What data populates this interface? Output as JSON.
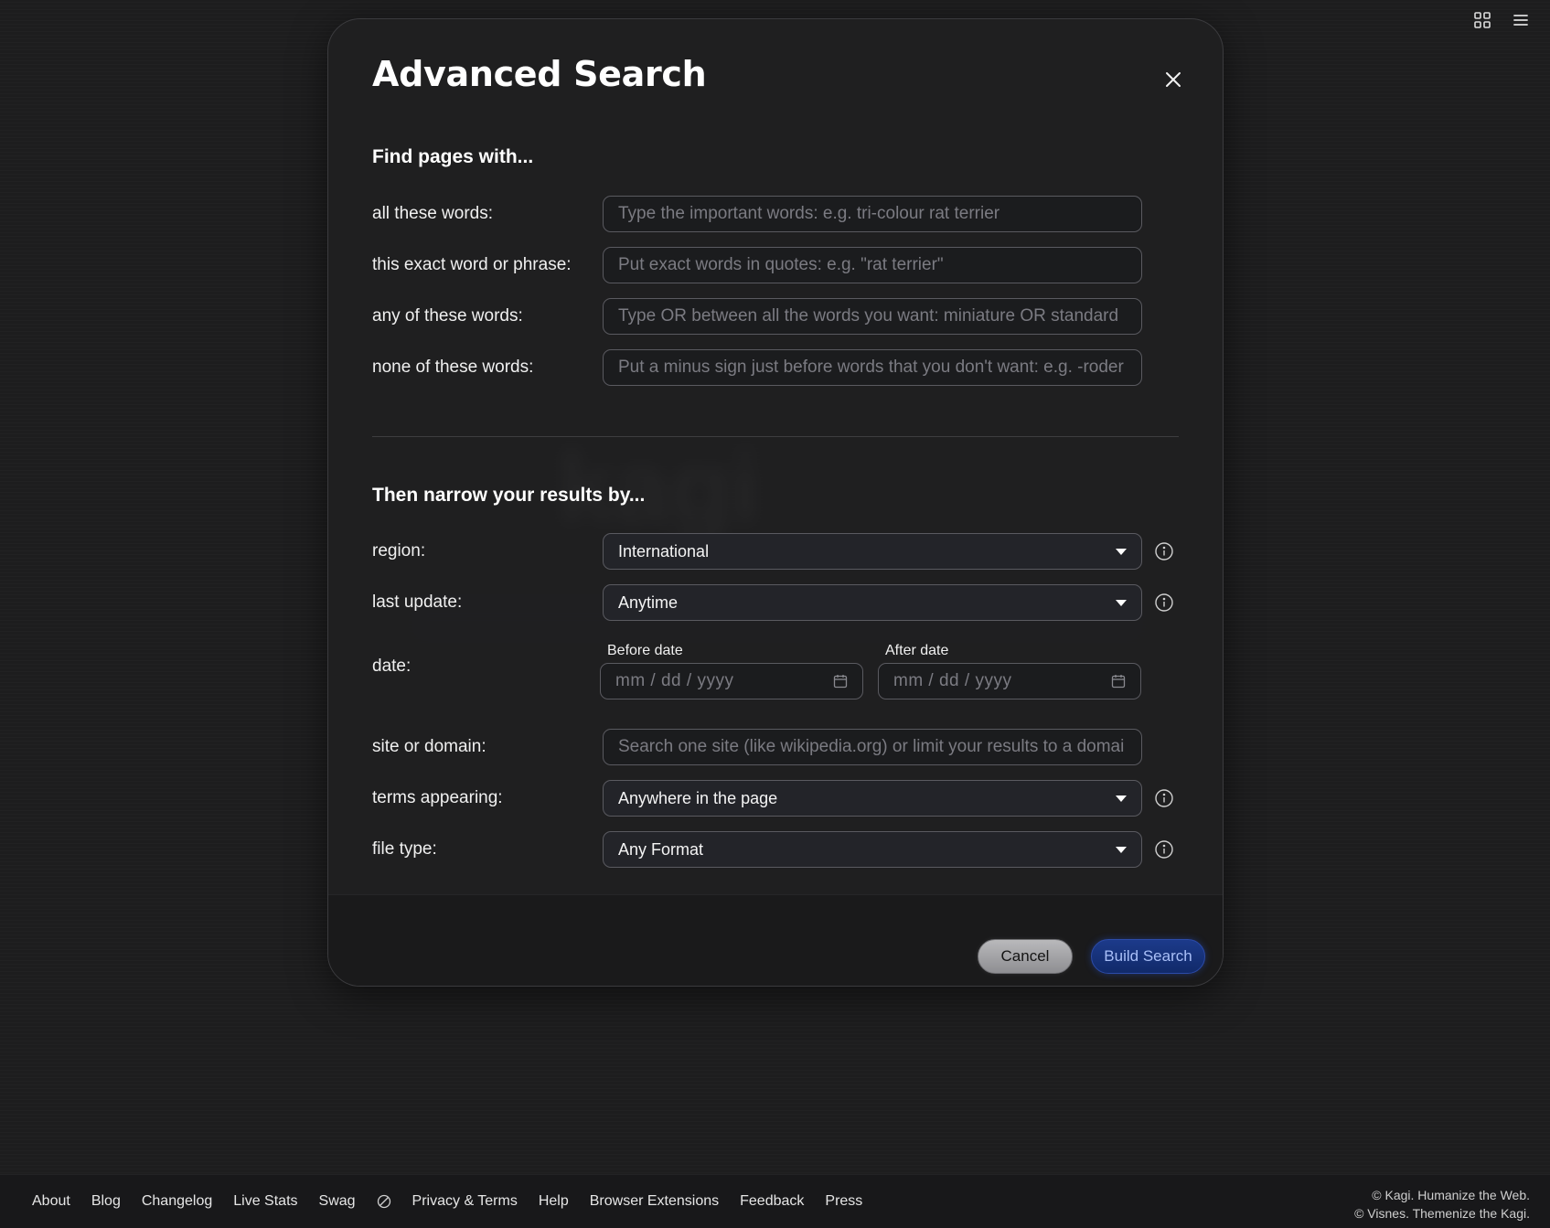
{
  "modal": {
    "title": "Advanced Search",
    "section1_heading": "Find pages with...",
    "section2_heading": "Then narrow your results by...",
    "fields": {
      "all_words": {
        "label": "all these words:",
        "placeholder": "Type the important words: e.g. tri-colour rat terrier",
        "value": ""
      },
      "exact_phrase": {
        "label": "this exact word or phrase:",
        "placeholder": "Put exact words in quotes: e.g. \"rat terrier\"",
        "value": ""
      },
      "any_words": {
        "label": "any of these words:",
        "placeholder": "Type OR between all the words you want: miniature OR standard",
        "value": ""
      },
      "none_words": {
        "label": "none of these words:",
        "placeholder": "Put a minus sign just before words that you don't want: e.g. -roder",
        "value": ""
      },
      "region": {
        "label": "region:",
        "value": "International"
      },
      "last_update": {
        "label": "last update:",
        "value": "Anytime"
      },
      "date": {
        "label": "date:",
        "before_label": "Before date",
        "after_label": "After date",
        "before_placeholder": "mm / dd / yyyy",
        "after_placeholder": "mm / dd / yyyy"
      },
      "site": {
        "label": "site or domain:",
        "placeholder": "Search one site (like wikipedia.org) or limit your results to a domai",
        "value": ""
      },
      "terms_appearing": {
        "label": "terms appearing:",
        "value": "Anywhere in the page"
      },
      "file_type": {
        "label": "file type:",
        "value": "Any Format"
      }
    },
    "buttons": {
      "cancel": "Cancel",
      "build": "Build Search"
    }
  },
  "background": {
    "logo_text": "kagi"
  },
  "top_icons": [
    "grid-icon",
    "menu-icon"
  ],
  "footer": {
    "links": [
      "About",
      "Blog",
      "Changelog",
      "Live Stats",
      "Swag",
      "Privacy & Terms",
      "Help",
      "Browser Extensions",
      "Feedback",
      "Press"
    ],
    "copyright_line1": "© Kagi. Humanize the Web.",
    "copyright_line2": "© Visnes. Themenize the Kagi."
  },
  "colors": {
    "background": "#1d1d1e",
    "modal": "#1f1f20",
    "accent_button": "#1c3a8a",
    "cancel_button": "#a3a3a6"
  }
}
